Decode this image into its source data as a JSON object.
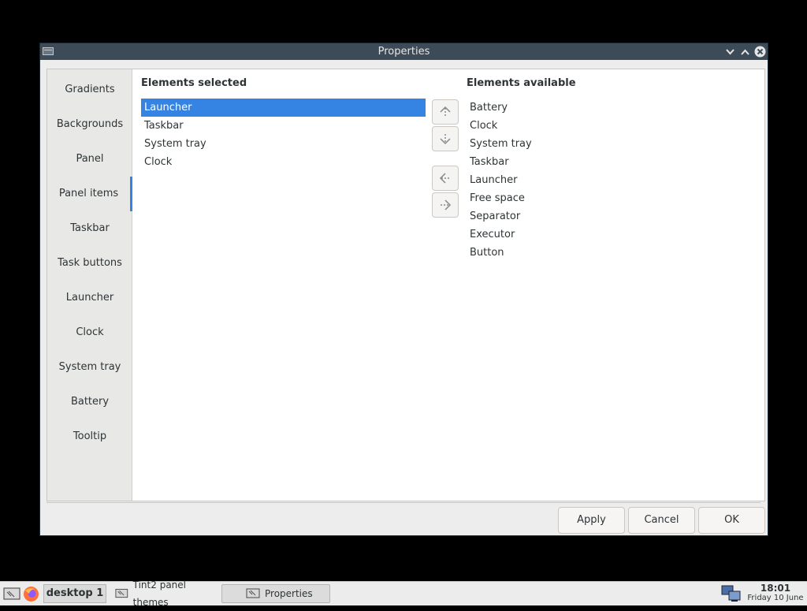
{
  "window": {
    "title": "Properties"
  },
  "sidebar": {
    "items": [
      {
        "label": "Gradients"
      },
      {
        "label": "Backgrounds"
      },
      {
        "label": "Panel"
      },
      {
        "label": "Panel items"
      },
      {
        "label": "Taskbar"
      },
      {
        "label": "Task buttons"
      },
      {
        "label": "Launcher"
      },
      {
        "label": "Clock"
      },
      {
        "label": "System tray"
      },
      {
        "label": "Battery"
      },
      {
        "label": "Tooltip"
      }
    ],
    "active": "Panel items"
  },
  "selected_panel": {
    "heading": "Elements selected",
    "items": [
      "Launcher",
      "Taskbar",
      "System tray",
      "Clock"
    ],
    "selected": "Launcher"
  },
  "available_panel": {
    "heading": "Elements available",
    "items": [
      "Battery",
      "Clock",
      "System tray",
      "Taskbar",
      "Launcher",
      "Free space",
      "Separator",
      "Executor",
      "Button"
    ]
  },
  "move_buttons": [
    "move-up-icon",
    "move-down-icon",
    "add-left-icon",
    "remove-right-icon"
  ],
  "footer": {
    "apply": "Apply",
    "cancel": "Cancel",
    "ok": "OK"
  },
  "taskbar": {
    "desktop": "desktop 1",
    "tasks": [
      "Tint2 panel themes",
      "Properties"
    ],
    "time": "18:01",
    "date": "Friday 10 June"
  },
  "colors": {
    "accent": "#3584e4",
    "titlebar": "#3c4b57"
  }
}
